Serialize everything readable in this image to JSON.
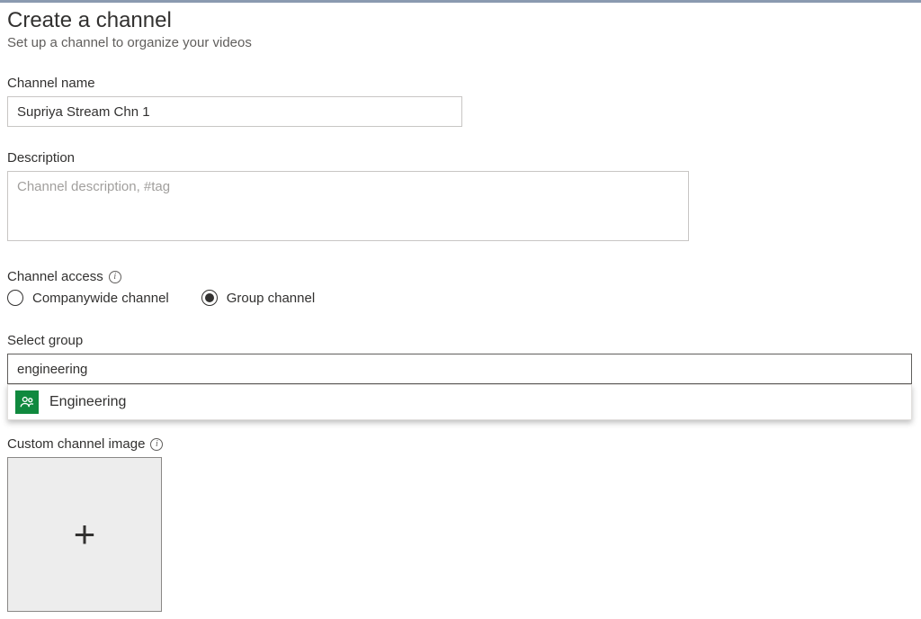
{
  "header": {
    "title": "Create a channel",
    "subtitle": "Set up a channel to organize your videos"
  },
  "channelName": {
    "label": "Channel name",
    "value": "Supriya Stream Chn 1"
  },
  "description": {
    "label": "Description",
    "placeholder": "Channel description, #tag",
    "value": ""
  },
  "channelAccess": {
    "label": "Channel access",
    "options": [
      {
        "label": "Companywide channel",
        "selected": false
      },
      {
        "label": "Group channel",
        "selected": true
      }
    ]
  },
  "selectGroup": {
    "label": "Select group",
    "value": "engineering",
    "suggestion": "Engineering"
  },
  "customImage": {
    "label": "Custom channel image"
  }
}
